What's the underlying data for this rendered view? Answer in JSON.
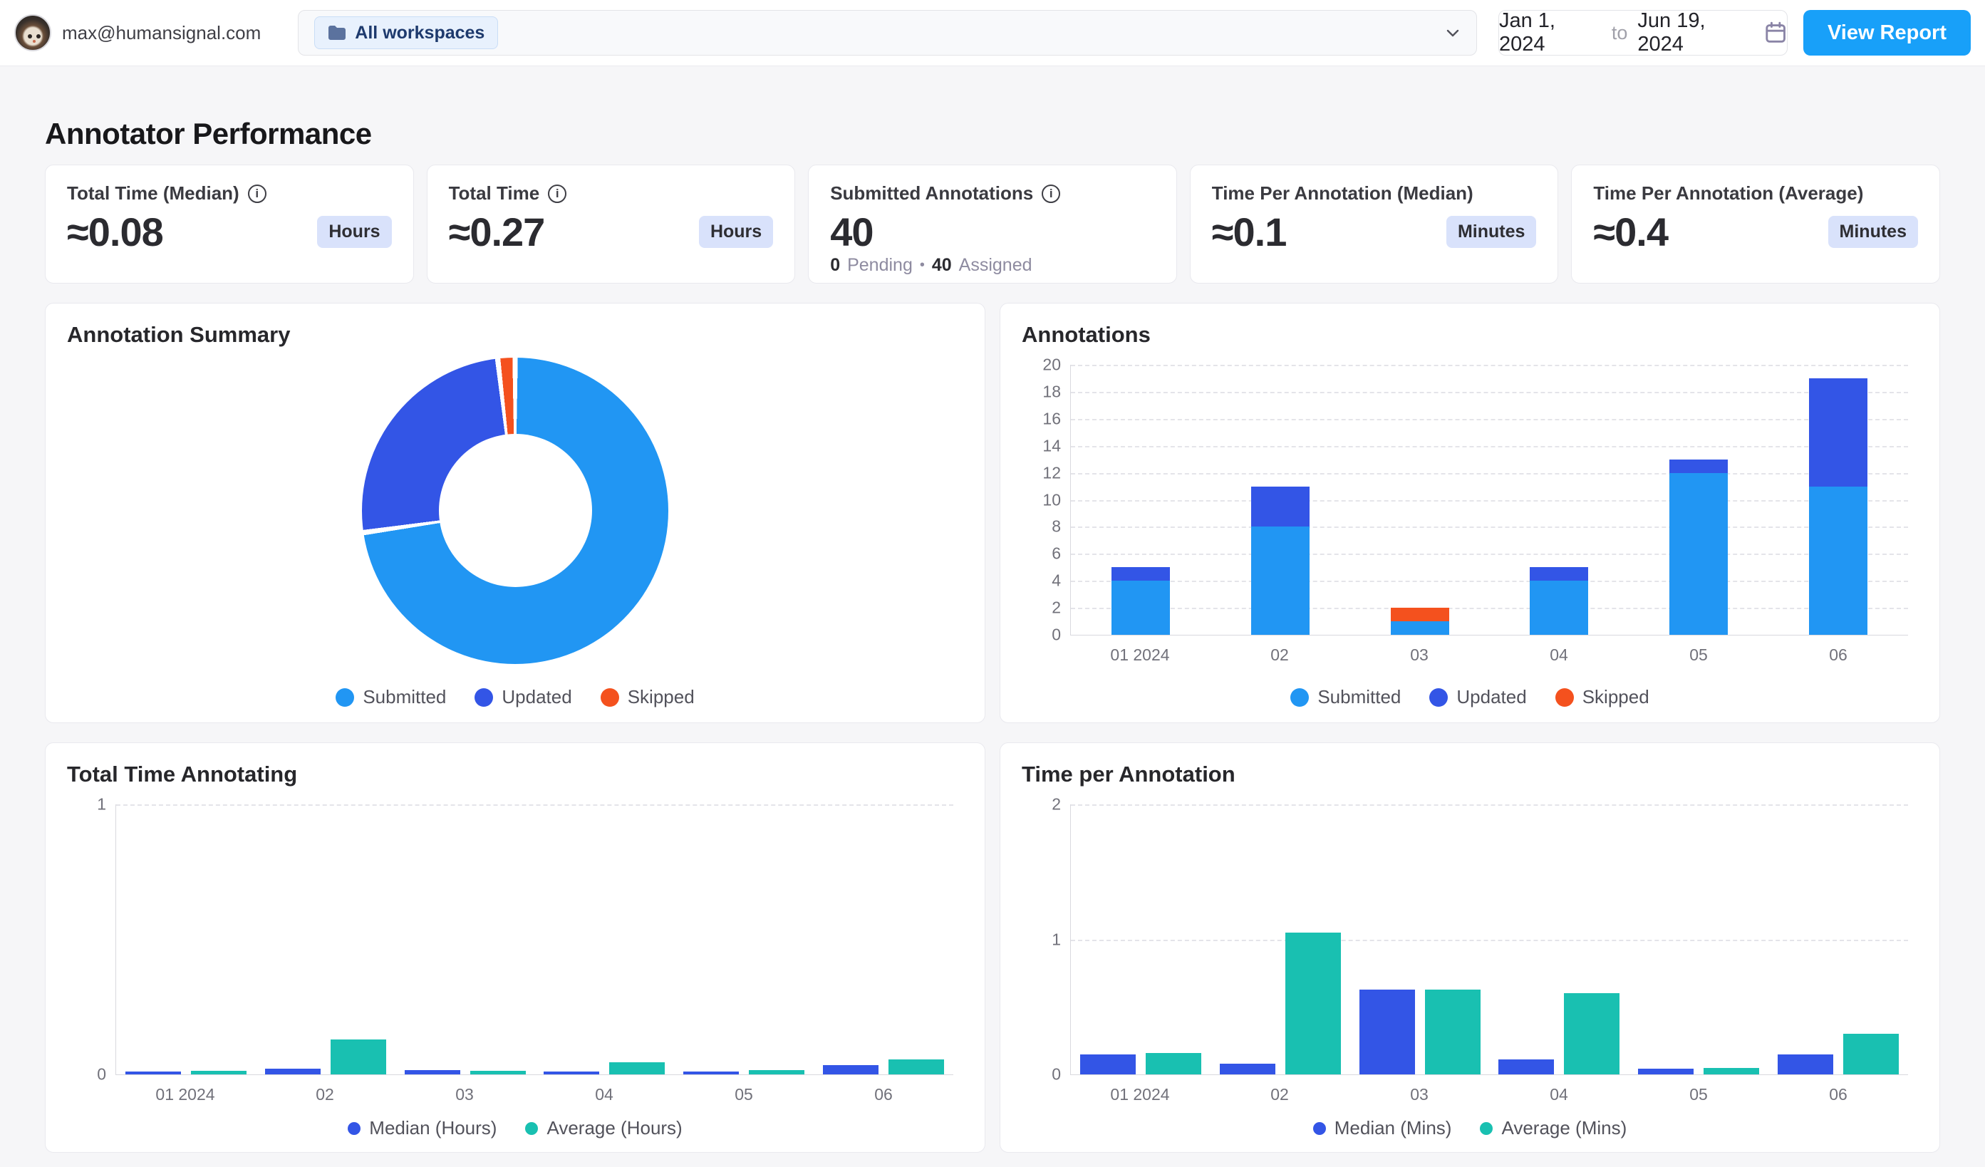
{
  "page": {
    "title": "Annotator Performance"
  },
  "topbar": {
    "user_email": "max@humansignal.com",
    "workspace_filter": {
      "selected": "All workspaces"
    },
    "date_range": {
      "start": "Jan 1, 2024",
      "separator": "to",
      "end": "Jun 19, 2024"
    },
    "view_report_label": "View Report"
  },
  "kpis": [
    {
      "title": "Total Time (Median)",
      "value": "≈0.08",
      "unit": "Hours"
    },
    {
      "title": "Total Time",
      "value": "≈0.27",
      "unit": "Hours"
    },
    {
      "title": "Submitted Annotations",
      "value": "40",
      "breakdown": {
        "pending_count": "0",
        "pending_label": "Pending",
        "separator": "•",
        "assigned_count": "40",
        "assigned_label": "Assigned"
      }
    },
    {
      "title": "Time Per Annotation (Median)",
      "value": "≈0.1",
      "unit": "Minutes"
    },
    {
      "title": "Time Per Annotation (Average)",
      "value": "≈0.4",
      "unit": "Minutes"
    }
  ],
  "colors": {
    "submitted": "#2196f3",
    "updated": "#3355e6",
    "skipped": "#f4511e",
    "average_teal": "#19c0b1",
    "accent_button": "#18a0f9"
  },
  "chart_data": [
    {
      "id": "annotation-summary",
      "type": "pie",
      "title": "Annotation Summary",
      "labels": [
        "Submitted",
        "Updated",
        "Skipped"
      ],
      "values": [
        40,
        14,
        1
      ],
      "colors": [
        "#2196f3",
        "#3355e6",
        "#f4511e"
      ],
      "donut": true,
      "legend_position": "bottom"
    },
    {
      "id": "annotations",
      "type": "bar",
      "stacked": true,
      "title": "Annotations",
      "categories": [
        "01 2024",
        "02",
        "03",
        "04",
        "05",
        "06"
      ],
      "series": [
        {
          "name": "Submitted",
          "color": "#2196f3",
          "values": [
            4,
            8,
            1,
            4,
            12,
            11
          ]
        },
        {
          "name": "Updated",
          "color": "#3355e6",
          "values": [
            1,
            3,
            0,
            1,
            1,
            8
          ]
        },
        {
          "name": "Skipped",
          "color": "#f4511e",
          "values": [
            0,
            0,
            1,
            0,
            0,
            0
          ]
        }
      ],
      "ylim": [
        0,
        20
      ],
      "yticks": [
        0,
        2,
        4,
        6,
        8,
        10,
        12,
        14,
        16,
        18,
        20
      ],
      "grid": "dashed-horizontal",
      "legend_position": "bottom",
      "legend_dot_size": 26
    },
    {
      "id": "total-time-annotating",
      "type": "bar",
      "stacked": false,
      "title": "Total Time Annotating",
      "categories": [
        "01 2024",
        "02",
        "03",
        "04",
        "05",
        "06"
      ],
      "series": [
        {
          "name": "Median (Hours)",
          "color": "#3355e6",
          "values": [
            0.01,
            0.02,
            0.015,
            0.01,
            0.01,
            0.035
          ]
        },
        {
          "name": "Average (Hours)",
          "color": "#19c0b1",
          "values": [
            0.012,
            0.13,
            0.012,
            0.045,
            0.015,
            0.055
          ]
        }
      ],
      "ylim": [
        0,
        1
      ],
      "yticks": [
        0,
        1
      ],
      "grid": "dashed-horizontal",
      "legend_position": "bottom",
      "legend_dot_size": 18
    },
    {
      "id": "time-per-annotation",
      "type": "bar",
      "stacked": false,
      "title": "Time per Annotation",
      "categories": [
        "01 2024",
        "02",
        "03",
        "04",
        "05",
        "06"
      ],
      "series": [
        {
          "name": "Median (Mins)",
          "color": "#3355e6",
          "values": [
            0.15,
            0.08,
            0.63,
            0.11,
            0.04,
            0.15
          ]
        },
        {
          "name": "Average (Mins)",
          "color": "#19c0b1",
          "values": [
            0.16,
            1.05,
            0.63,
            0.6,
            0.05,
            0.3
          ]
        }
      ],
      "ylim": [
        0,
        2
      ],
      "yticks": [
        0,
        1,
        2
      ],
      "grid": "dashed-horizontal",
      "legend_position": "bottom",
      "legend_dot_size": 18
    }
  ]
}
